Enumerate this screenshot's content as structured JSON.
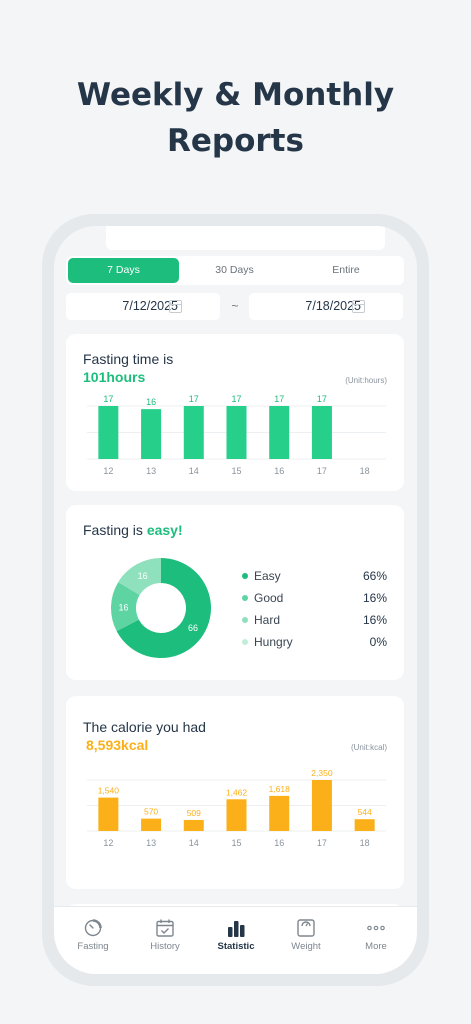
{
  "headline": {
    "line1": "Weekly & Monthly",
    "line2": "Reports"
  },
  "period_tabs": [
    {
      "label": "7 Days",
      "active": true
    },
    {
      "label": "30 Days",
      "active": false
    },
    {
      "label": "Entire",
      "active": false
    }
  ],
  "date_range": {
    "start": "7/12/2025",
    "separator": "~",
    "end": "7/18/2025"
  },
  "fasting_card": {
    "title": "Fasting time is",
    "total": "101hours",
    "unit": "(Unit:hours)"
  },
  "mood_card": {
    "title_prefix": "Fasting is ",
    "title_highlight": "easy!"
  },
  "calorie_card": {
    "title": "The calorie you had",
    "total": "8,593kcal",
    "unit": "(Unit:kcal)"
  },
  "bottom_nav": [
    {
      "label": "Fasting",
      "icon": "timer-icon",
      "active": false
    },
    {
      "label": "History",
      "icon": "calendar-check-icon",
      "active": false
    },
    {
      "label": "Statistic",
      "icon": "bar-chart-icon",
      "active": true
    },
    {
      "label": "Weight",
      "icon": "scale-icon",
      "active": false
    },
    {
      "label": "More",
      "icon": "more-dots-icon",
      "active": false
    }
  ],
  "colors": {
    "green": "#1dbd7d",
    "bar_green": "#26d08b",
    "orange": "#fbb01a",
    "text": "#253648"
  },
  "chart_data": [
    {
      "type": "bar",
      "categories": [
        "12",
        "13",
        "14",
        "15",
        "16",
        "17",
        "18"
      ],
      "values": [
        17,
        16,
        17,
        17,
        17,
        17,
        null
      ],
      "labels": [
        "17",
        "16",
        "17",
        "17",
        "17",
        "17",
        ""
      ],
      "ylim": [
        0,
        17
      ],
      "grid": true
    },
    {
      "type": "pie",
      "series": [
        {
          "name": "Easy",
          "value": 66,
          "label": "66",
          "pct": "66%",
          "color": "#1dbd7d"
        },
        {
          "name": "Good",
          "value": 16,
          "label": "16",
          "pct": "16%",
          "color": "#5fd4a3"
        },
        {
          "name": "Hard",
          "value": 16,
          "label": "16",
          "pct": "16%",
          "color": "#8fe0bd"
        },
        {
          "name": "Hungry",
          "value": 0,
          "label": "",
          "pct": "0%",
          "color": "#c2eed9"
        }
      ]
    },
    {
      "type": "bar",
      "categories": [
        "12",
        "13",
        "14",
        "15",
        "16",
        "17",
        "18"
      ],
      "values": [
        1540,
        570,
        509,
        1462,
        1618,
        2350,
        544
      ],
      "labels": [
        "1,540",
        "570",
        "509",
        "1,462",
        "1,618",
        "2,350",
        "544"
      ],
      "ylim": [
        0,
        2350
      ],
      "grid": true
    }
  ]
}
